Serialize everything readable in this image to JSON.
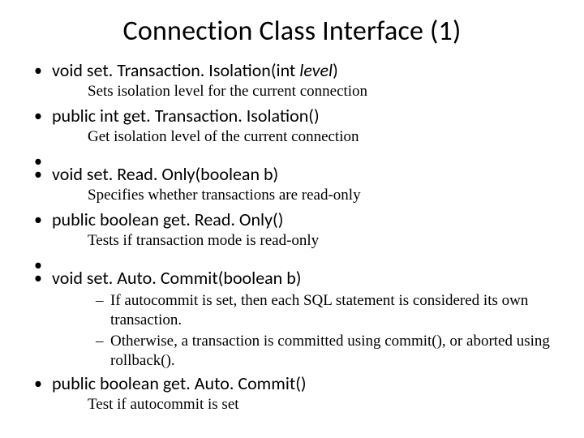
{
  "title": "Connection Class Interface (1)",
  "items": [
    {
      "sig_prefix": "void set. Transaction. Isolation(int ",
      "sig_italic": "level",
      "sig_suffix": ")",
      "desc": "Sets isolation level for the current connection"
    },
    {
      "sig": "public int get. Transaction. Isolation()",
      "desc": "Get isolation level of the current connection"
    },
    {
      "sig": "void set. Read. Only(boolean b)",
      "desc": "Specifies whether transactions are read-only"
    },
    {
      "sig": "public boolean get. Read. Only()",
      "desc": "Tests if transaction mode is read-only"
    },
    {
      "sig": "void set. Auto. Commit(boolean b)",
      "sub": [
        "If autocommit is set, then each SQL statement is considered its own transaction.",
        "Otherwise, a transaction is committed using commit(), or aborted using rollback()."
      ]
    },
    {
      "sig": "public boolean get. Auto. Commit()",
      "desc": "Test if autocommit is set"
    }
  ]
}
